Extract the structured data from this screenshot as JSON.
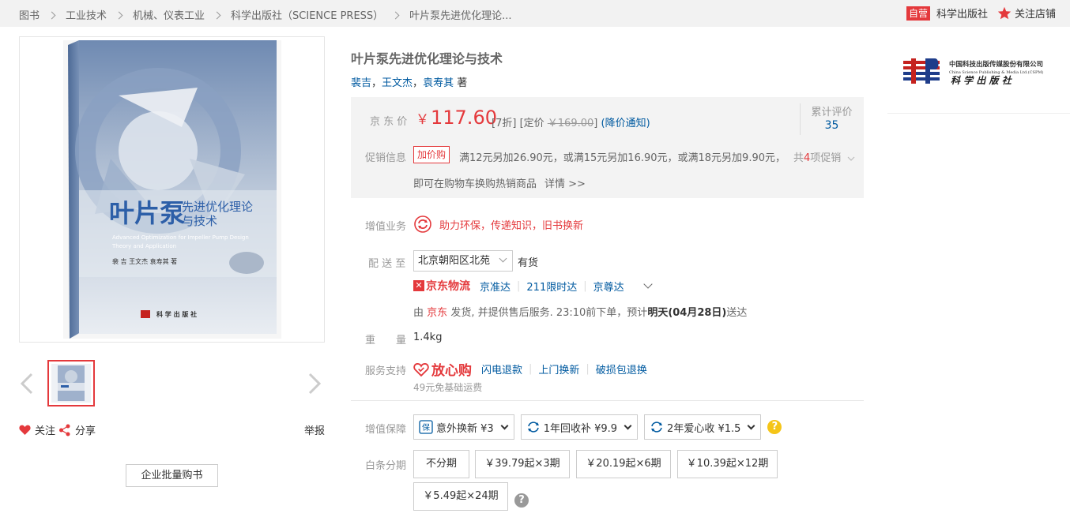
{
  "breadcrumb": {
    "items": [
      "图书",
      "工业技术",
      "机械、仪表工业",
      "科学出版社（SCIENCE PRESS）",
      "叶片泵先进优化理论..."
    ]
  },
  "shop": {
    "badge": "自营",
    "name": "科学出版社",
    "follow_label": "关注店铺"
  },
  "product": {
    "title": "叶片泵先进优化理论与技术",
    "authors": [
      "裴吉",
      "王文杰",
      "袁寿其"
    ],
    "author_separator": "，",
    "author_suffix": "著"
  },
  "book_cover": {
    "title_big": "叶片泵",
    "title_small_line1": "先进优化理论",
    "title_small_line2": "与技术",
    "english_line1": "Advanced Optimization for Impeller Pump Design",
    "english_line2": "Theory and Application",
    "authors": "裴 吉  王文杰  袁寿其  著",
    "publisher": "科 学 出 版 社"
  },
  "preview_actions": {
    "follow": "关注",
    "share": "分享",
    "report": "举报",
    "bulk_buy": "企业批量购书"
  },
  "price": {
    "label": "京 东 价",
    "currency": "￥",
    "value": "117.60",
    "discount": "[7折]",
    "list_prefix": "[定价",
    "list_price": "￥169.00",
    "list_suffix": "]",
    "notify": "(降价通知)",
    "rating_label": "累计评价",
    "rating_count": "35"
  },
  "promotion": {
    "label": "促销信息",
    "tag": "加价购",
    "text": "满12元另加26.90元，或满15元另加16.90元，或满18元另加9.90元，",
    "line2": "即可在购物车换购热销商品",
    "details": "详情 >>",
    "count_prefix": "共",
    "count": "4",
    "count_suffix": "项促销"
  },
  "value_added": {
    "label": "增值业务",
    "text": "助力环保，传递知识，旧书换新"
  },
  "delivery": {
    "label": "配 送 至",
    "address": "北京朝阳区北苑",
    "stock": "有货",
    "logistics_brand": "京东物流",
    "options": [
      "京准达",
      "211限时达",
      "京尊达"
    ],
    "ship_prefix": "由",
    "ship_seller": "京东",
    "ship_text": "发货, 并提供售后服务. 23:10前下单，预计",
    "ship_date": "明天(04月28日)",
    "ship_suffix": "送达"
  },
  "weight": {
    "label": "重　　量",
    "value": "1.4kg"
  },
  "service": {
    "label": "服务支持",
    "brand": "放心购",
    "items": [
      "闪电退款",
      "上门换新",
      "破损包退换"
    ],
    "free_shipping": "49元免基础运费"
  },
  "guarantee": {
    "label": "增值保障",
    "options": [
      {
        "icon": "insurance-icon",
        "text": "意外换新 ¥3"
      },
      {
        "icon": "recycle-icon",
        "text": "1年回收补  ¥9.9"
      },
      {
        "icon": "recycle-icon",
        "text": "2年爱心收 ¥1.5"
      }
    ],
    "help_glyph": "?"
  },
  "installments": {
    "label": "白条分期",
    "options": [
      "不分期",
      "￥39.79起×3期",
      "￥20.19起×6期",
      "￥10.39起×12期",
      "￥5.49起×24期"
    ],
    "help_glyph": "?"
  },
  "publisher_logo": {
    "cn_name": "中国科技出版传媒股份有限公司",
    "en_name": "China Science Publishing & Media Ltd.(CSPM)",
    "mark_text": "科 学 出 版 社"
  },
  "colors": {
    "accent_red": "#e4393c",
    "link_blue": "#005aa0",
    "help_yellow": "#f5c518",
    "help_gray": "#999999"
  }
}
